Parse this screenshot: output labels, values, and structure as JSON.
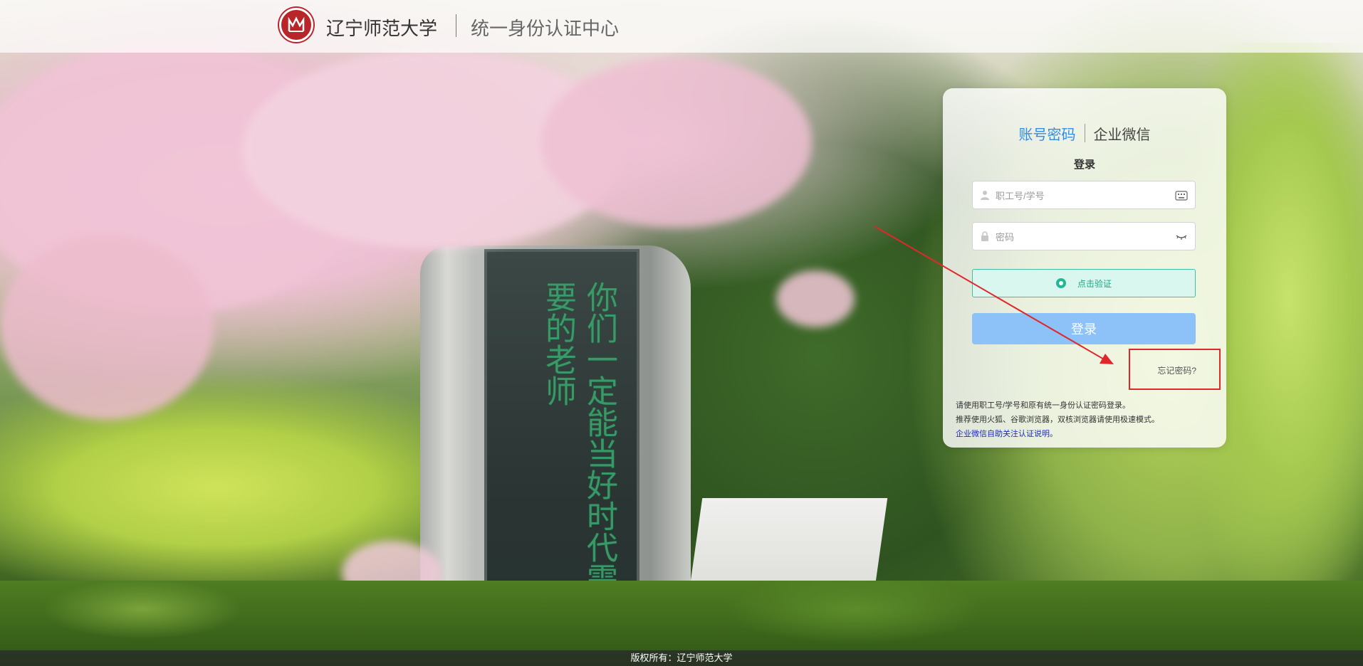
{
  "header": {
    "university_name": "辽宁师范大学",
    "center_name": "统一身份认证中心"
  },
  "background": {
    "inscription": "你们一定能当好时代需要的老师"
  },
  "login": {
    "tabs": [
      {
        "label": "账号密码",
        "active": true
      },
      {
        "label": "企业微信",
        "active": false
      }
    ],
    "title": "登录",
    "username_placeholder": "职工号/学号",
    "password_placeholder": "密码",
    "verify_label": "点击验证",
    "submit_label": "登录",
    "forgot_label": "忘记密码?",
    "hint_line1": "请使用职工号/学号和原有统一身份认证密码登录。",
    "hint_line2": "推荐使用火狐、谷歌浏览器，双核浏览器请使用极速模式。",
    "hint_link": "企业微信自助关注认证说明。"
  },
  "footer": {
    "copyright": "版权所有：辽宁师范大学"
  },
  "colors": {
    "accent": "#2f8de4",
    "login_button": "#8cc2f8",
    "verify_green": "#20b893",
    "annotation_red": "#e0282a"
  }
}
